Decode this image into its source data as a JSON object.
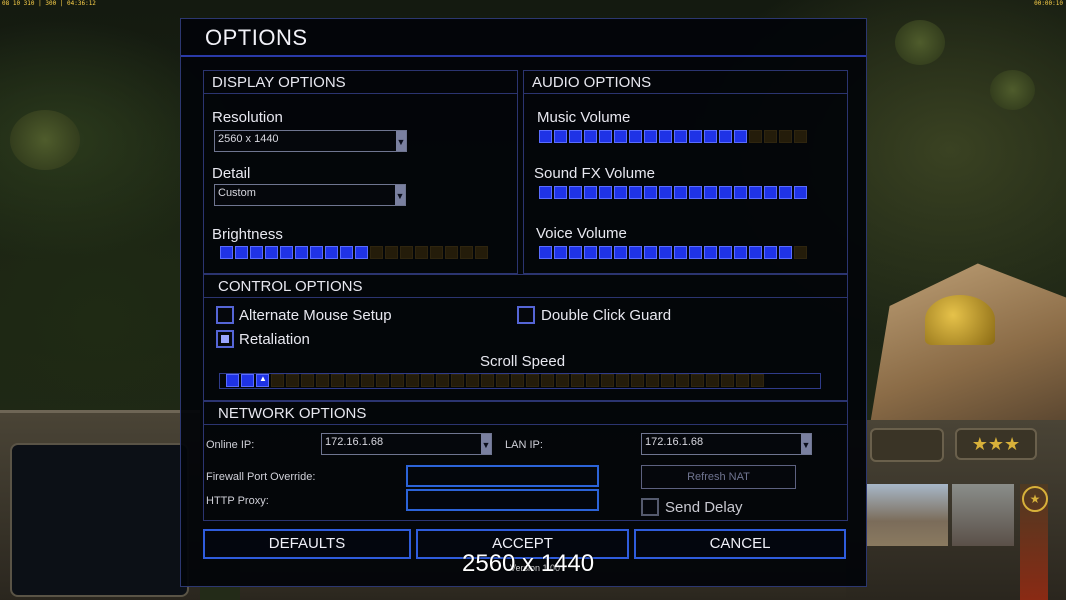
{
  "hud": {
    "top_left": "08 10 310 | 300 | 04:36:12",
    "top_right": "00:00:10",
    "stars": "★★★"
  },
  "dialog": {
    "title": "OPTIONS"
  },
  "display": {
    "heading": "DISPLAY OPTIONS",
    "resolution_label": "Resolution",
    "resolution_value": "2560 x 1440",
    "detail_label": "Detail",
    "detail_value": "Custom",
    "brightness_label": "Brightness",
    "brightness_level": 10,
    "brightness_max": 18
  },
  "audio": {
    "heading": "AUDIO OPTIONS",
    "music_label": "Music Volume",
    "music_level": 14,
    "music_max": 18,
    "sfx_label": "Sound FX Volume",
    "sfx_level": 18,
    "sfx_max": 18,
    "voice_label": "Voice Volume",
    "voice_level": 17,
    "voice_max": 18
  },
  "control": {
    "heading": "CONTROL OPTIONS",
    "alt_mouse_label": "Alternate Mouse Setup",
    "alt_mouse_checked": false,
    "double_click_label": "Double Click Guard",
    "double_click_checked": false,
    "retaliation_label": "Retaliation",
    "retaliation_checked": true,
    "scroll_label": "Scroll Speed",
    "scroll_level": 3,
    "scroll_max": 36
  },
  "network": {
    "heading": "NETWORK OPTIONS",
    "online_ip_label": "Online IP:",
    "online_ip_value": "172.16.1.68",
    "lan_ip_label": "LAN IP:",
    "lan_ip_value": "172.16.1.68",
    "firewall_label": "Firewall Port Override:",
    "firewall_value": "",
    "http_proxy_label": "HTTP Proxy:",
    "http_proxy_value": "",
    "refresh_nat_label": "Refresh NAT",
    "send_delay_label": "Send Delay",
    "send_delay_checked": false
  },
  "buttons": {
    "defaults": "DEFAULTS",
    "accept": "ACCEPT",
    "cancel": "CANCEL"
  },
  "overlay": {
    "resolution_text": "2560 x 1440",
    "version_text": "Version 1.00"
  },
  "colors": {
    "accent_blue": "#1f33e6",
    "border_blue": "#2b3470",
    "slider_off": "#241c0a"
  }
}
